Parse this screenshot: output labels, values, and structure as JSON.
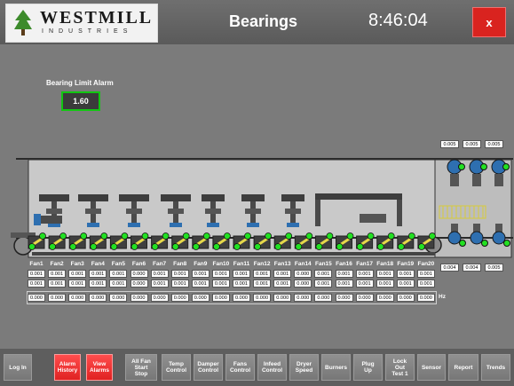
{
  "header": {
    "logo_word": "WESTMILL",
    "logo_sub": "INDUSTRIES",
    "title": "Bearings",
    "clock": "8:46:04",
    "close_label": "x"
  },
  "alarm": {
    "label": "Bearing Limit Alarm",
    "value": "1.60"
  },
  "fans": [
    {
      "name": "Fan1",
      "r1": "0.001",
      "r2": "0.001",
      "hz": "0.000"
    },
    {
      "name": "Fan2",
      "r1": "0.001",
      "r2": "0.001",
      "hz": "0.000"
    },
    {
      "name": "Fan3",
      "r1": "0.001",
      "r2": "0.001",
      "hz": "0.000"
    },
    {
      "name": "Fan4",
      "r1": "0.001",
      "r2": "0.001",
      "hz": "0.000"
    },
    {
      "name": "Fan5",
      "r1": "0.001",
      "r2": "0.001",
      "hz": "0.000"
    },
    {
      "name": "Fan6",
      "r1": "0.000",
      "r2": "0.000",
      "hz": "0.000"
    },
    {
      "name": "Fan7",
      "r1": "0.001",
      "r2": "0.001",
      "hz": "0.000"
    },
    {
      "name": "Fan8",
      "r1": "0.001",
      "r2": "0.001",
      "hz": "0.000"
    },
    {
      "name": "Fan9",
      "r1": "0.001",
      "r2": "0.001",
      "hz": "0.000"
    },
    {
      "name": "Fan10",
      "r1": "0.001",
      "r2": "0.001",
      "hz": "0.000"
    },
    {
      "name": "Fan11",
      "r1": "0.001",
      "r2": "0.001",
      "hz": "0.000"
    },
    {
      "name": "Fan12",
      "r1": "0.001",
      "r2": "0.001",
      "hz": "0.000"
    },
    {
      "name": "Fan13",
      "r1": "0.001",
      "r2": "0.001",
      "hz": "0.000"
    },
    {
      "name": "Fan14",
      "r1": "0.000",
      "r2": "0.000",
      "hz": "0.000"
    },
    {
      "name": "Fan15",
      "r1": "0.001",
      "r2": "0.001",
      "hz": "0.000"
    },
    {
      "name": "Fan16",
      "r1": "0.001",
      "r2": "0.001",
      "hz": "0.000"
    },
    {
      "name": "Fan17",
      "r1": "0.001",
      "r2": "0.001",
      "hz": "0.000"
    },
    {
      "name": "Fan18",
      "r1": "0.001",
      "r2": "0.001",
      "hz": "0.000"
    },
    {
      "name": "Fan19",
      "r1": "0.001",
      "r2": "0.001",
      "hz": "0.000"
    },
    {
      "name": "Fan20",
      "r1": "0.001",
      "r2": "0.001",
      "hz": "0.000"
    }
  ],
  "hz_unit": "Hz",
  "side_top": [
    "0.005",
    "0.005",
    "0.005"
  ],
  "side_bottom": [
    "0.004",
    "0.004",
    "0.005"
  ],
  "footer": [
    {
      "label": "Log In",
      "style": "grey"
    },
    {
      "label": "Alarm\nHistory",
      "style": "red"
    },
    {
      "label": "View\nAlarms",
      "style": "red"
    },
    {
      "label": "All Fan\nStart\nStop",
      "style": "grey"
    },
    {
      "label": "Temp\nControl",
      "style": "grey"
    },
    {
      "label": "Damper\nControl",
      "style": "grey"
    },
    {
      "label": "Fans\nControl",
      "style": "grey"
    },
    {
      "label": "Infeed\nControl",
      "style": "grey"
    },
    {
      "label": "Dryer\nSpeed",
      "style": "grey"
    },
    {
      "label": "Burners",
      "style": "grey"
    },
    {
      "label": "Plug\nUp",
      "style": "grey"
    },
    {
      "label": "Lock\nOut\nTest 1",
      "style": "grey"
    },
    {
      "label": "Sensor",
      "style": "grey"
    },
    {
      "label": "Report",
      "style": "grey"
    },
    {
      "label": "Trends",
      "style": "grey"
    }
  ],
  "colors": {
    "status_ok": "#22e022",
    "alarm_border": "#11c711",
    "close_red": "#d9231f",
    "button_red": "#f03a3a"
  }
}
